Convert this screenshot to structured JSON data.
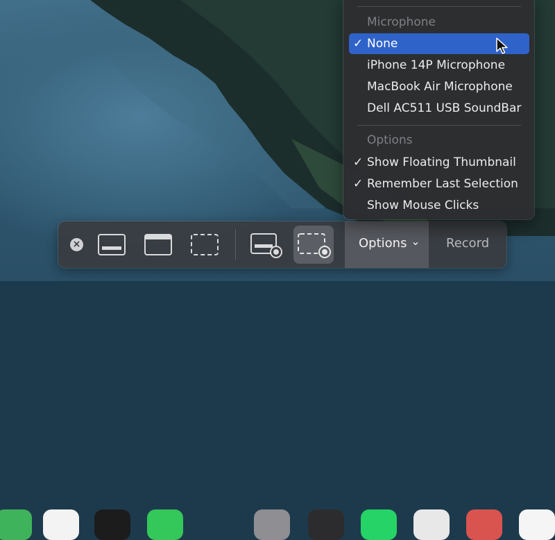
{
  "menu": {
    "microphone_header": "Microphone",
    "microphone_items": [
      {
        "label": "None",
        "checked": true,
        "highlighted": true
      },
      {
        "label": "iPhone 14P Microphone",
        "checked": false
      },
      {
        "label": "MacBook Air Microphone",
        "checked": false
      },
      {
        "label": "Dell AC511 USB SoundBar",
        "checked": false
      }
    ],
    "options_header": "Options",
    "options_items": [
      {
        "label": "Show Floating Thumbnail",
        "checked": true
      },
      {
        "label": "Remember Last Selection",
        "checked": true
      },
      {
        "label": "Show Mouse Clicks",
        "checked": false
      }
    ],
    "check_glyph": "✓"
  },
  "toolbar": {
    "options_label": "Options",
    "options_chevron": "⌄",
    "record_label": "Record",
    "close_glyph": "×",
    "buttons": [
      {
        "icon": "capture-entire-screen-icon"
      },
      {
        "icon": "capture-window-icon"
      },
      {
        "icon": "capture-selection-icon"
      },
      {
        "icon": "record-entire-screen-icon"
      },
      {
        "icon": "record-selection-icon",
        "active": true
      }
    ]
  },
  "colors": {
    "highlight": "#2f63c9"
  }
}
